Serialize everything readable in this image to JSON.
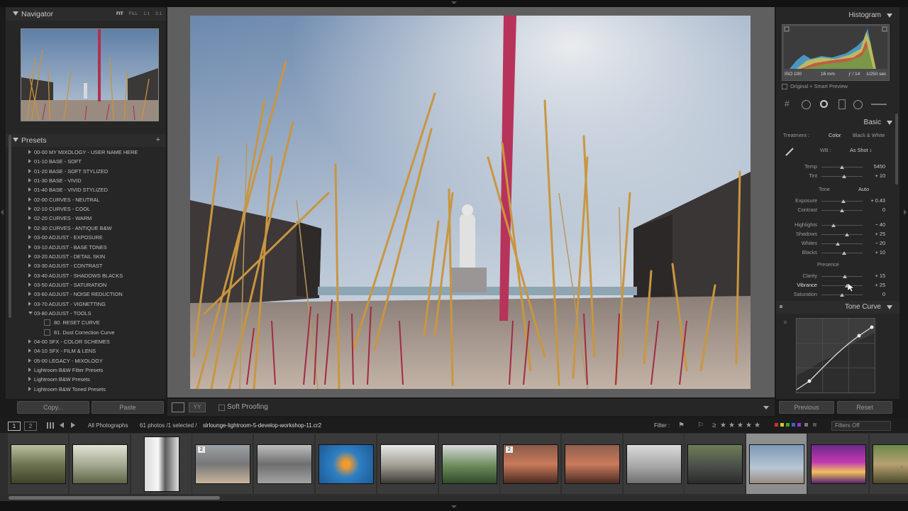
{
  "navigator": {
    "title": "Navigator",
    "zoom_options": [
      "FIT",
      "FILL",
      "1:1",
      "3:1"
    ]
  },
  "presets": {
    "title": "Presets",
    "add_label": "+",
    "items": [
      "00-00 MY MIXOLOGY - USER NAME HERE",
      "01-10 BASE - SOFT",
      "01-20 BASE - SOFT STYLIZED",
      "01-30 BASE - VIVID",
      "01-40 BASE - VIVID STYLIZED",
      "02-00 CURVES - NEUTRAL",
      "02-10 CURVES - COOL",
      "02-20 CURVES - WARM",
      "02-30 CURVES - ANTIQUE B&W",
      "03-00 ADJUST - EXPOSURE",
      "03-10 ADJUST - BASE TONES",
      "03-20 ADJUST - DETAIL SKIN",
      "03-30 ADJUST - CONTRAST",
      "03-40 ADJUST - SHADOWS BLACKS",
      "03-50 ADJUST - SATURATION",
      "03-60 ADJUST - NOISE REDUCTION",
      "03-70 ADJUST - VIGNETTING",
      "03-80 ADJUST - TOOLS"
    ],
    "sub_items": [
      "80. RESET CURVE",
      "81. Dust Correction Curve"
    ],
    "items_after": [
      "04-00 SFX - COLOR SCHEMES",
      "04-10 SFX - FILM & LENS",
      "05-00 LEGACY - MIXOLOGY",
      "Lightroom B&W Filter Presets",
      "Lightroom B&W Presets",
      "Lightroom B&W Toned Presets"
    ]
  },
  "left_buttons": {
    "copy": "Copy...",
    "paste": "Paste"
  },
  "toolbar": {
    "soft_proofing": "Soft Proofing"
  },
  "histogram": {
    "title": "Histogram",
    "iso": "ISO 100",
    "focal": "16 mm",
    "aperture": "ƒ / 14",
    "shutter": "1/250 sec",
    "preview": "Original + Smart Preview"
  },
  "basic": {
    "title": "Basic",
    "treatment_label": "Treatment :",
    "treatment_color": "Color",
    "treatment_bw": "Black & White",
    "wb_label": "WB :",
    "wb_value": "As Shot ↕",
    "tone_label": "Tone",
    "auto_label": "Auto",
    "presence_label": "Presence",
    "sliders": [
      {
        "label": "Temp",
        "value": "5450",
        "level": 0.5
      },
      {
        "label": "Tint",
        "value": "+ 10",
        "level": 0.56
      },
      {
        "label": "Exposure",
        "value": "+ 0.43",
        "level": 0.54
      },
      {
        "label": "Contrast",
        "value": "0",
        "level": 0.5
      },
      {
        "label": "Highlights",
        "value": "− 40",
        "level": 0.3
      },
      {
        "label": "Shadows",
        "value": "+ 25",
        "level": 0.62
      },
      {
        "label": "Whites",
        "value": "− 20",
        "level": 0.4
      },
      {
        "label": "Blacks",
        "value": "+ 10",
        "level": 0.55
      },
      {
        "label": "Clarity",
        "value": "+ 15",
        "level": 0.57
      },
      {
        "label": "Vibrance",
        "value": "+ 25",
        "level": 0.62
      },
      {
        "label": "Saturation",
        "value": "0",
        "level": 0.5
      }
    ]
  },
  "tone_curve": {
    "title": "Tone Curve"
  },
  "right_buttons": {
    "previous": "Previous",
    "reset": "Reset"
  },
  "filmbar": {
    "page1": "1",
    "page2": "2",
    "source": "All Photographs",
    "count": "61 photos /1 selected /",
    "filename": "slrlounge-lightroom-5-develop-workshop-11.cr2",
    "filter_label": "Filter :",
    "filters_off": "Filters Off"
  },
  "film_badges": [
    "2",
    "2"
  ],
  "colors": {
    "panel": "#262626",
    "center_bg": "#5f5f5f",
    "selected_cell": "#8e8e8e"
  }
}
